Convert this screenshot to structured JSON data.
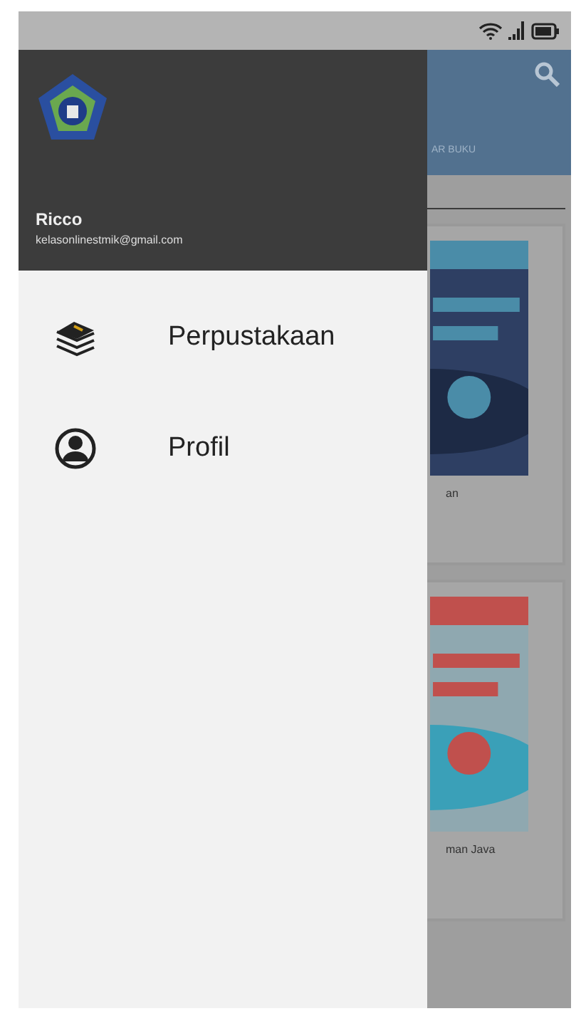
{
  "drawer": {
    "user": {
      "name": "Ricco",
      "email": "kelasonlinestmik@gmail.com"
    },
    "items": [
      {
        "kind": "library",
        "label": "Perpustakaan"
      },
      {
        "kind": "profile",
        "label": "Profil"
      }
    ]
  },
  "background": {
    "tab": "AR BUKU",
    "books": [
      {
        "caption": "an"
      },
      {
        "caption": "man Java"
      }
    ]
  }
}
